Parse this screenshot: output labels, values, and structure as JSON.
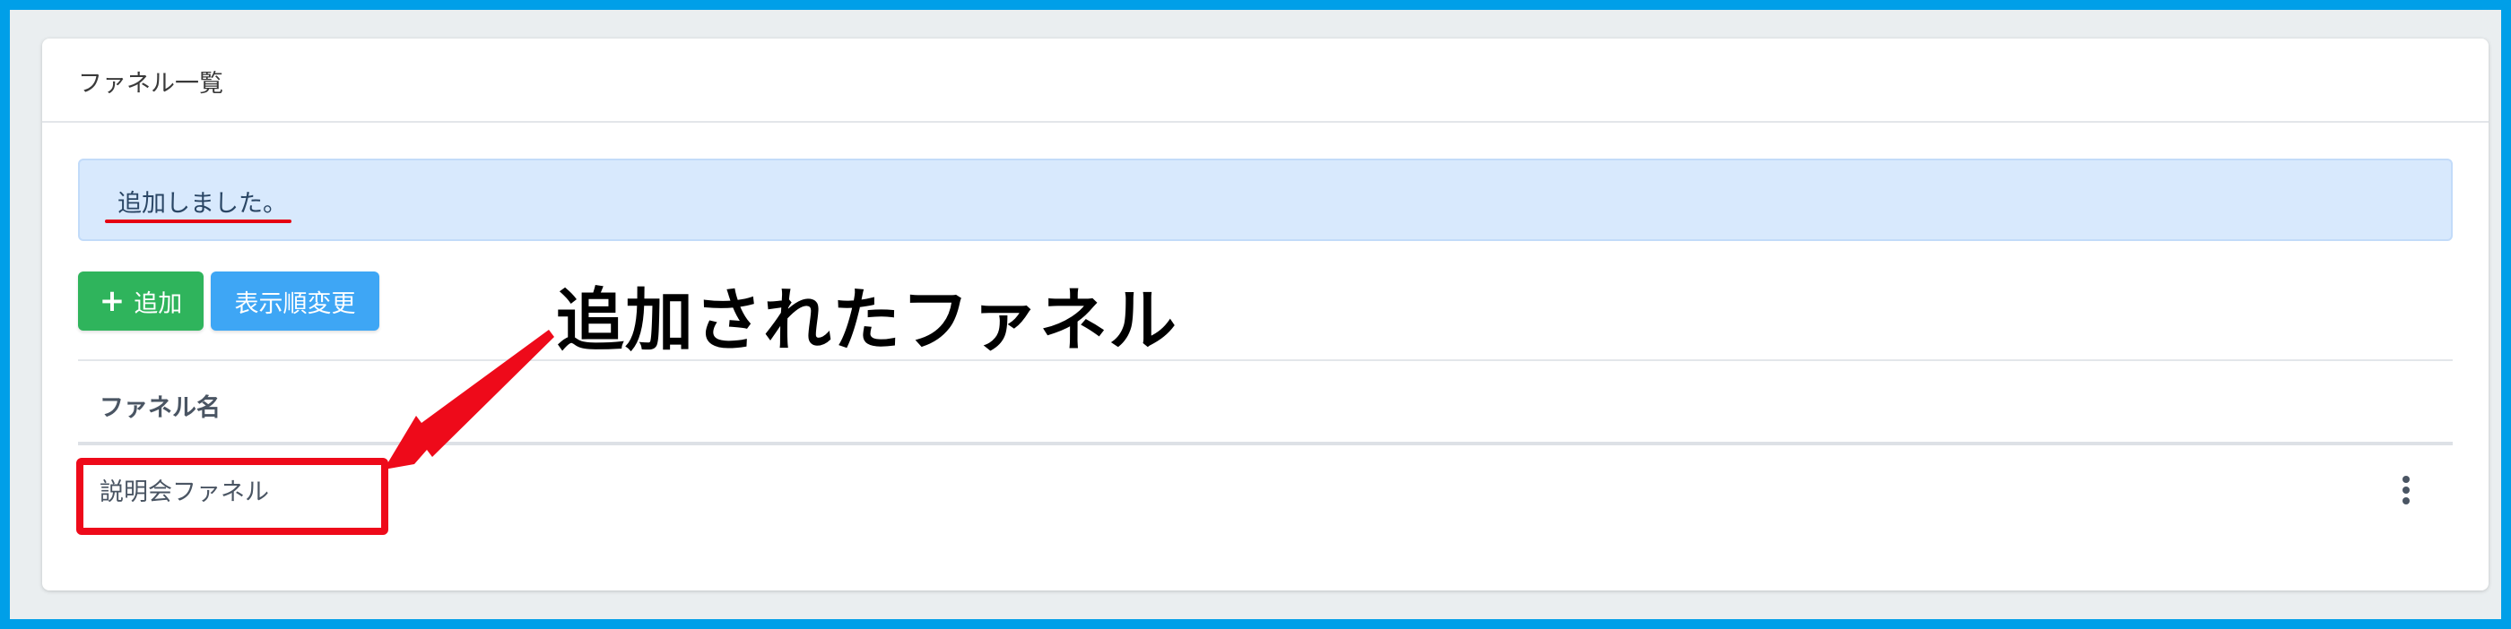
{
  "card": {
    "title": "ファネル一覧"
  },
  "alert": {
    "message": "追加しました。"
  },
  "toolbar": {
    "add_plus": "+",
    "add_label": "追加",
    "order_label": "表示順変更"
  },
  "table": {
    "headers": [
      "ファネル名"
    ],
    "rows": [
      {
        "name": "説明会ファネル"
      }
    ]
  },
  "annotation": {
    "callout_text": "追加されたファネル"
  },
  "colors": {
    "frame": "#009fe8",
    "add_button": "#2fb45c",
    "order_button": "#3ea6f5",
    "alert_bg": "#d8e9fd",
    "annotation_red": "#ee0a1a"
  },
  "icons": {
    "row_menu": "kebab-menu-icon",
    "add": "plus-icon",
    "arrow": "arrow-icon"
  }
}
